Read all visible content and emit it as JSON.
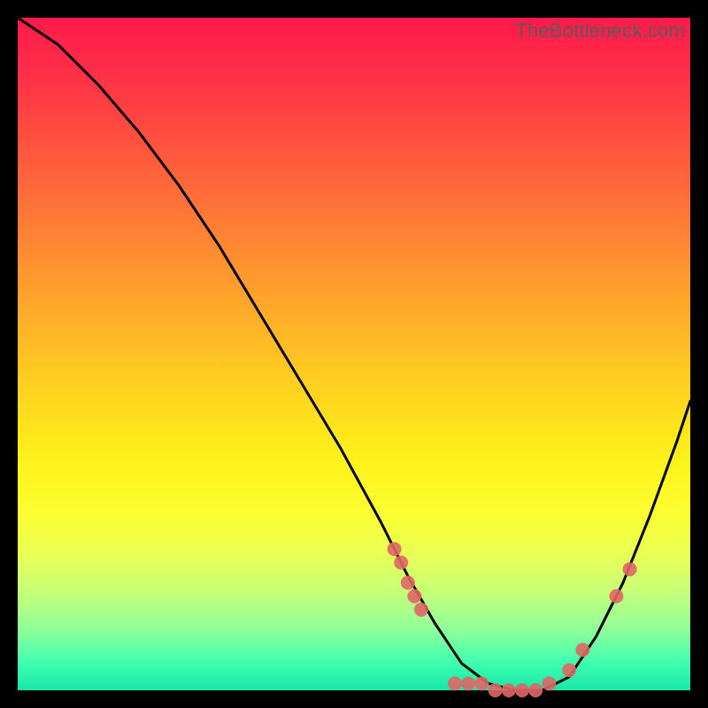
{
  "watermark": "TheBottleneck.com",
  "chart_data": {
    "type": "line",
    "title": "",
    "xlabel": "",
    "ylabel": "",
    "xlim": [
      0,
      100
    ],
    "ylim": [
      0,
      100
    ],
    "grid": false,
    "legend": false,
    "series": [
      {
        "name": "curve",
        "x": [
          0,
          6,
          12,
          18,
          24,
          30,
          36,
          42,
          48,
          54,
          58,
          62,
          66,
          70,
          74,
          78,
          82,
          86,
          90,
          94,
          98,
          100
        ],
        "y": [
          100,
          96,
          90,
          83,
          75,
          66,
          56,
          46,
          36,
          25,
          17,
          10,
          4,
          1,
          0,
          0,
          2,
          8,
          16,
          26,
          37,
          43
        ],
        "color": "#000000"
      }
    ],
    "markers": [
      {
        "x": 56,
        "y": 21,
        "color": "#e06666"
      },
      {
        "x": 57,
        "y": 19,
        "color": "#e06666"
      },
      {
        "x": 58,
        "y": 16,
        "color": "#e06666"
      },
      {
        "x": 59,
        "y": 14,
        "color": "#e06666"
      },
      {
        "x": 60,
        "y": 12,
        "color": "#e06666"
      },
      {
        "x": 65,
        "y": 1,
        "color": "#e06666"
      },
      {
        "x": 67,
        "y": 1,
        "color": "#e06666"
      },
      {
        "x": 69,
        "y": 1,
        "color": "#e06666"
      },
      {
        "x": 71,
        "y": 0,
        "color": "#e06666"
      },
      {
        "x": 73,
        "y": 0,
        "color": "#e06666"
      },
      {
        "x": 75,
        "y": 0,
        "color": "#e06666"
      },
      {
        "x": 77,
        "y": 0,
        "color": "#e06666"
      },
      {
        "x": 79,
        "y": 1,
        "color": "#e06666"
      },
      {
        "x": 82,
        "y": 3,
        "color": "#e06666"
      },
      {
        "x": 84,
        "y": 6,
        "color": "#e06666"
      },
      {
        "x": 89,
        "y": 14,
        "color": "#e06666"
      },
      {
        "x": 91,
        "y": 18,
        "color": "#e06666"
      }
    ]
  }
}
